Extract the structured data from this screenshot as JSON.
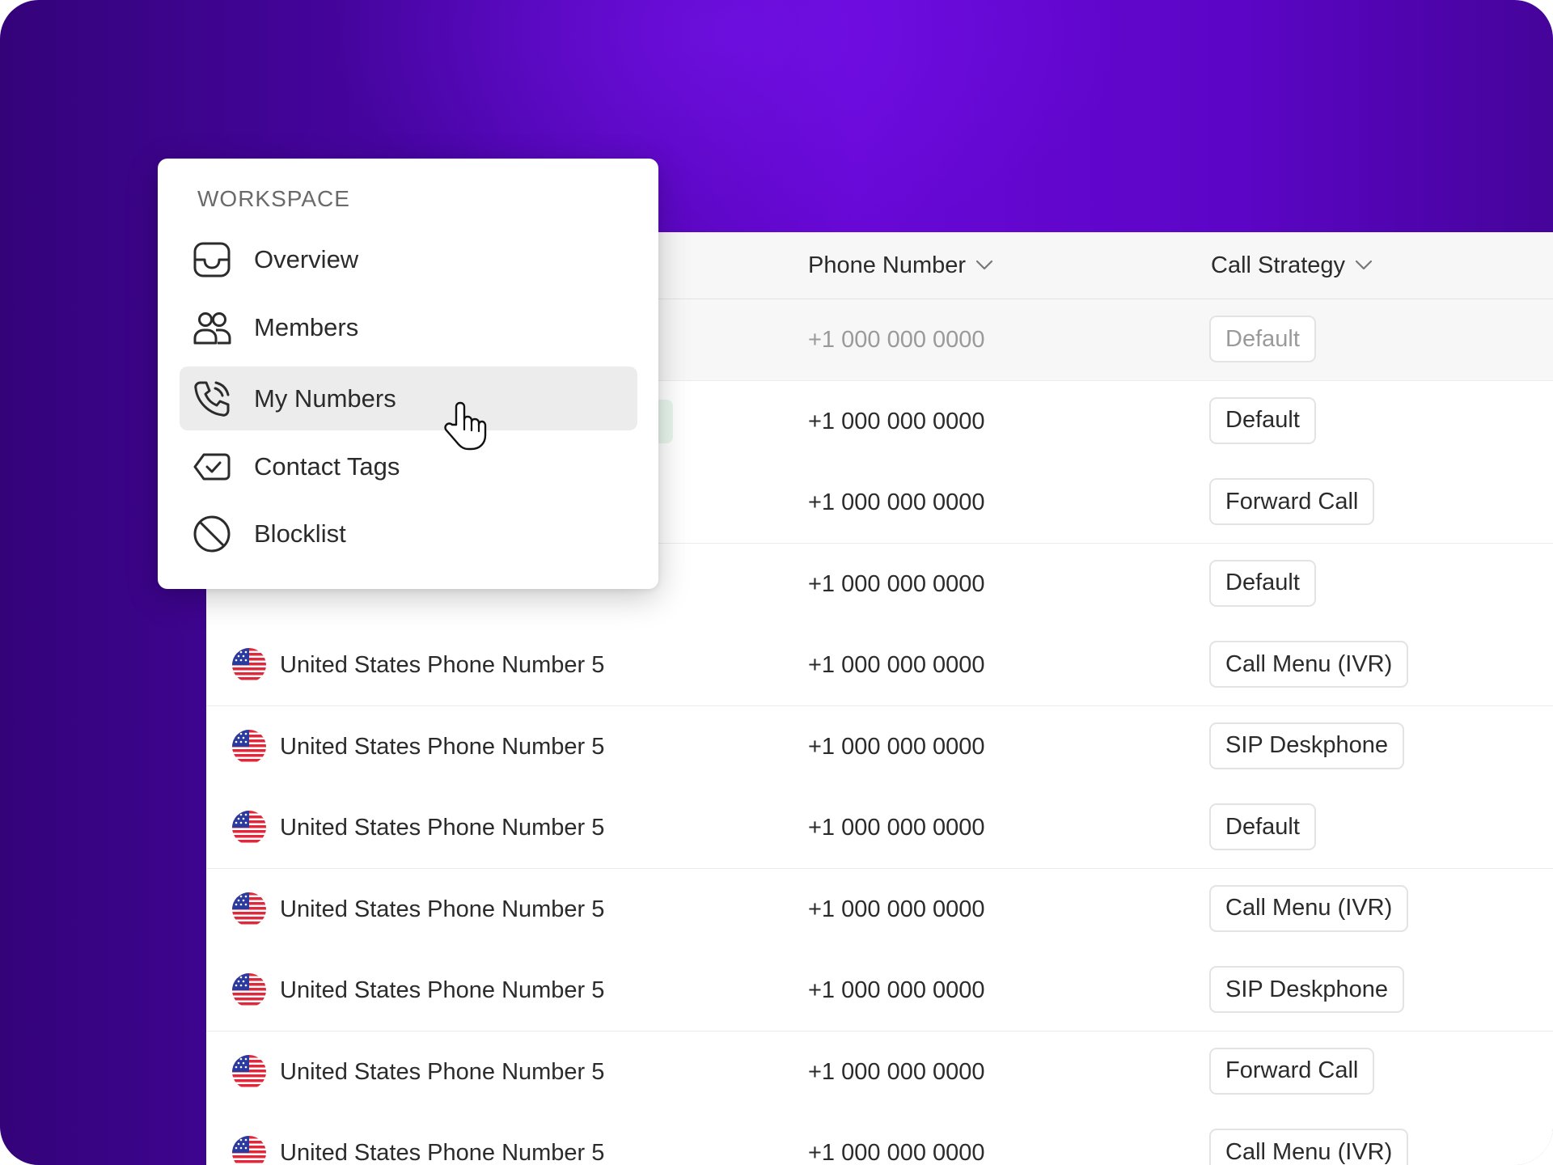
{
  "table": {
    "columns": {
      "phone_number": "Phone Number",
      "call_strategy": "Call Strategy"
    },
    "rows": [
      {
        "name": "",
        "phone": "+1 000 000 0000",
        "strategy": "Default",
        "dim": true
      },
      {
        "name": "",
        "phone": "+1 000 000 0000",
        "strategy": "Default"
      },
      {
        "name": "",
        "phone": "+1 000 000 0000",
        "strategy": "Forward Call"
      },
      {
        "name": "",
        "phone": "+1 000 000 0000",
        "strategy": "Default"
      },
      {
        "name": "United States Phone Number 5",
        "phone": "+1 000 000 0000",
        "strategy": "Call Menu (IVR)"
      },
      {
        "name": "United States Phone Number 5",
        "phone": "+1 000 000 0000",
        "strategy": "SIP Deskphone"
      },
      {
        "name": "United States Phone Number 5",
        "phone": "+1 000 000 0000",
        "strategy": "Default"
      },
      {
        "name": "United States Phone Number 5",
        "phone": "+1 000 000 0000",
        "strategy": "Call Menu (IVR)"
      },
      {
        "name": "United States Phone Number 5",
        "phone": "+1 000 000 0000",
        "strategy": "SIP Deskphone"
      },
      {
        "name": "United States Phone Number 5",
        "phone": "+1 000 000 0000",
        "strategy": "Forward Call"
      },
      {
        "name": "United States Phone Number 5",
        "phone": "+1 000 000 0000",
        "strategy": "Call Menu (IVR)"
      }
    ]
  },
  "menu": {
    "heading": "WORKSPACE",
    "items": [
      {
        "label": "Overview",
        "icon": "inbox-icon"
      },
      {
        "label": "Members",
        "icon": "users-icon"
      },
      {
        "label": "My Numbers",
        "icon": "phone-icon",
        "active": true
      },
      {
        "label": "Contact Tags",
        "icon": "tag-check-icon"
      },
      {
        "label": "Blocklist",
        "icon": "block-icon"
      }
    ]
  },
  "colors": {
    "background_purple": "#5c05c6",
    "active_item": "#ececec",
    "flag_red": "#e0283c",
    "flag_blue": "#2a3a9e"
  }
}
